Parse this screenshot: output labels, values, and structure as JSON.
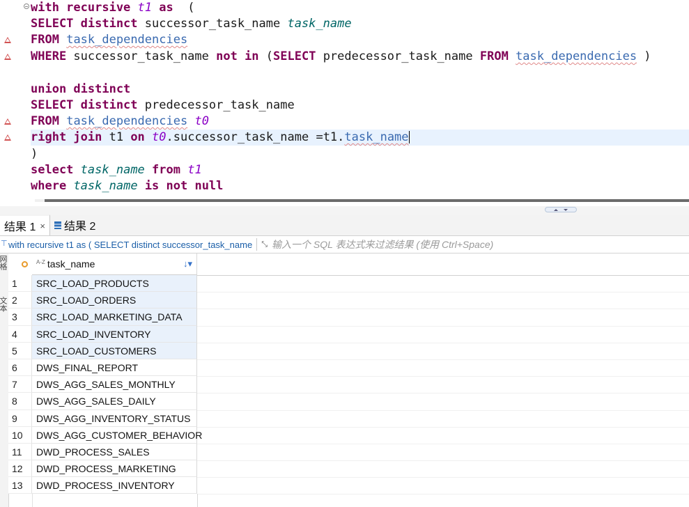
{
  "editor": {
    "lines": [
      [
        [
          "kw",
          "with recursive "
        ],
        [
          "it2",
          "t1"
        ],
        [
          "kw",
          " as"
        ],
        [
          "",
          "  ("
        ]
      ],
      [
        [
          "kw",
          "SELECT distinct"
        ],
        [
          "",
          " successor_task_name "
        ],
        [
          "it",
          "task_name"
        ]
      ],
      [
        [
          "kw",
          "FROM"
        ],
        [
          "",
          " "
        ],
        [
          "tbl",
          "task_dependencies"
        ]
      ],
      [
        [
          "kw",
          "WHERE"
        ],
        [
          "",
          " successor_task_name "
        ],
        [
          "kw",
          "not in"
        ],
        [
          "",
          " ("
        ],
        [
          "kw",
          "SELECT"
        ],
        [
          "",
          " predecessor_task_name "
        ],
        [
          "kw",
          "FROM"
        ],
        [
          "",
          " "
        ],
        [
          "tbl",
          "task_dependencies"
        ],
        [
          "",
          " )"
        ]
      ],
      [
        [
          "",
          ""
        ]
      ],
      [
        [
          "kw",
          "union distinct"
        ]
      ],
      [
        [
          "kw",
          "SELECT distinct"
        ],
        [
          "",
          " predecessor_task_name"
        ]
      ],
      [
        [
          "kw",
          "FROM"
        ],
        [
          "",
          " "
        ],
        [
          "tbl",
          "task_dependencies"
        ],
        [
          "",
          " "
        ],
        [
          "it2",
          "t0"
        ]
      ],
      [
        [
          "kw",
          "right join"
        ],
        [
          "",
          " t1 "
        ],
        [
          "kw",
          "on"
        ],
        [
          "",
          " "
        ],
        [
          "it2",
          "t0"
        ],
        [
          "",
          ".successor_task_name =t1."
        ],
        [
          "tbl",
          "task_name"
        ]
      ],
      [
        [
          "",
          ")"
        ]
      ],
      [
        [
          "kw",
          "select"
        ],
        [
          "",
          " "
        ],
        [
          "it",
          "task_name"
        ],
        [
          "",
          " "
        ],
        [
          "kw",
          "from"
        ],
        [
          "",
          " "
        ],
        [
          "it2",
          "t1"
        ]
      ],
      [
        [
          "kw",
          "where"
        ],
        [
          "",
          " "
        ],
        [
          "it",
          "task_name"
        ],
        [
          "",
          " "
        ],
        [
          "kw",
          "is not null"
        ]
      ]
    ],
    "warning_lines": [
      2,
      3,
      7,
      8
    ],
    "current_line": 8
  },
  "tabs": [
    {
      "label": "结果 1",
      "close": "×",
      "active": true
    },
    {
      "label": "结果 2",
      "close": "",
      "active": false
    }
  ],
  "filter": {
    "query": "with recursive t1 as ( SELECT distinct successor_task_name",
    "placeholder": "输入一个 SQL 表达式来过滤结果 (使用 Ctrl+Space)",
    "expand_icon": "expand-icon"
  },
  "side_tabs": [
    "网格",
    "文本"
  ],
  "grid": {
    "column": {
      "type_icon": "A-Z",
      "name": "task_name",
      "sort_icon": "↓▾"
    },
    "rows": [
      {
        "n": "1",
        "v": "SRC_LOAD_PRODUCTS"
      },
      {
        "n": "2",
        "v": "SRC_LOAD_ORDERS"
      },
      {
        "n": "3",
        "v": "SRC_LOAD_MARKETING_DATA"
      },
      {
        "n": "4",
        "v": "SRC_LOAD_INVENTORY"
      },
      {
        "n": "5",
        "v": "SRC_LOAD_CUSTOMERS"
      },
      {
        "n": "6",
        "v": "DWS_FINAL_REPORT"
      },
      {
        "n": "7",
        "v": "DWS_AGG_SALES_MONTHLY"
      },
      {
        "n": "8",
        "v": "DWS_AGG_SALES_DAILY"
      },
      {
        "n": "9",
        "v": "DWS_AGG_INVENTORY_STATUS"
      },
      {
        "n": "10",
        "v": "DWS_AGG_CUSTOMER_BEHAVIOR"
      },
      {
        "n": "11",
        "v": "DWD_PROCESS_SALES"
      },
      {
        "n": "12",
        "v": "DWD_PROCESS_MARKETING"
      },
      {
        "n": "13",
        "v": "DWD_PROCESS_INVENTORY"
      }
    ],
    "selected_rows": [
      0,
      1,
      2,
      3,
      4
    ]
  },
  "colors": {
    "keyword": "#7f0055",
    "alias": "#8a00c6",
    "column": "#006666",
    "table": "#3a6ab0",
    "warning": "#d25252",
    "selection": "#e9f1fb"
  }
}
